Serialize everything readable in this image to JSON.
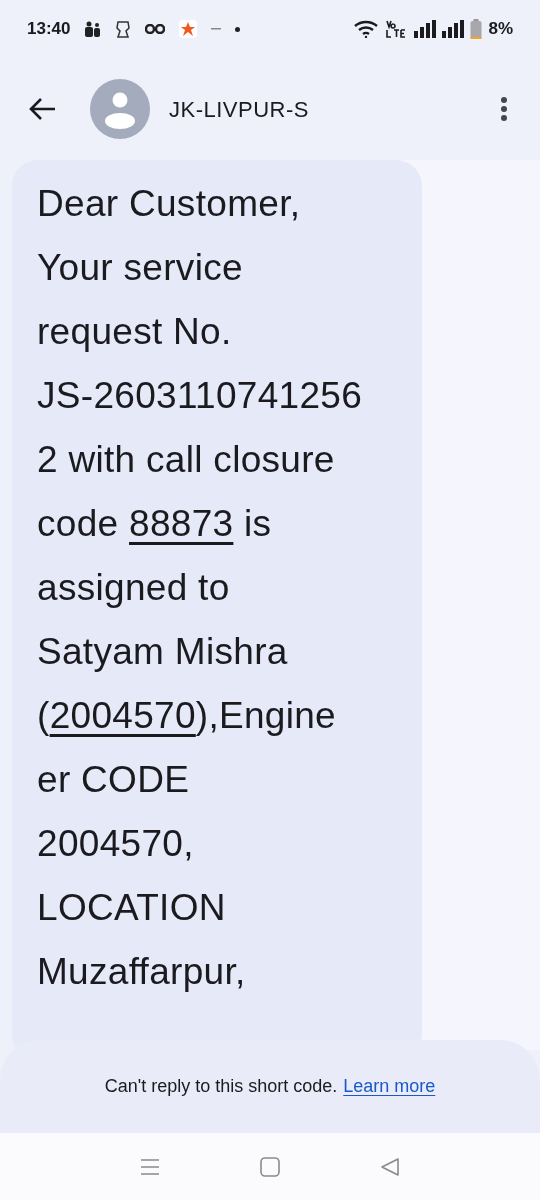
{
  "status_bar": {
    "time": "13:40",
    "battery": "8%"
  },
  "header": {
    "title": "JK-LIVPUR-S"
  },
  "message": {
    "lines": [
      [
        {
          "text": "Dear Customer,"
        }
      ],
      [
        {
          "text": "Your service"
        }
      ],
      [
        {
          "text": "request No."
        }
      ],
      [
        {
          "text": "JS-2603110741256"
        }
      ],
      [
        {
          "text": "2 with call closure"
        }
      ],
      [
        {
          "text": "code "
        },
        {
          "text": "88873",
          "link": true
        },
        {
          "text": " is"
        }
      ],
      [
        {
          "text": "assigned to"
        }
      ],
      [
        {
          "text": "Satyam Mishra"
        }
      ],
      [
        {
          "text": "("
        },
        {
          "text": "2004570",
          "link": true
        },
        {
          "text": "),Engine"
        }
      ],
      [
        {
          "text": "er CODE"
        }
      ],
      [
        {
          "text": "2004570,"
        }
      ],
      [
        {
          "text": "LOCATION"
        }
      ],
      [
        {
          "text": "Muzaffarpur,"
        }
      ]
    ]
  },
  "footer": {
    "notice": "Can't reply to this short code.",
    "link": "Learn more"
  }
}
